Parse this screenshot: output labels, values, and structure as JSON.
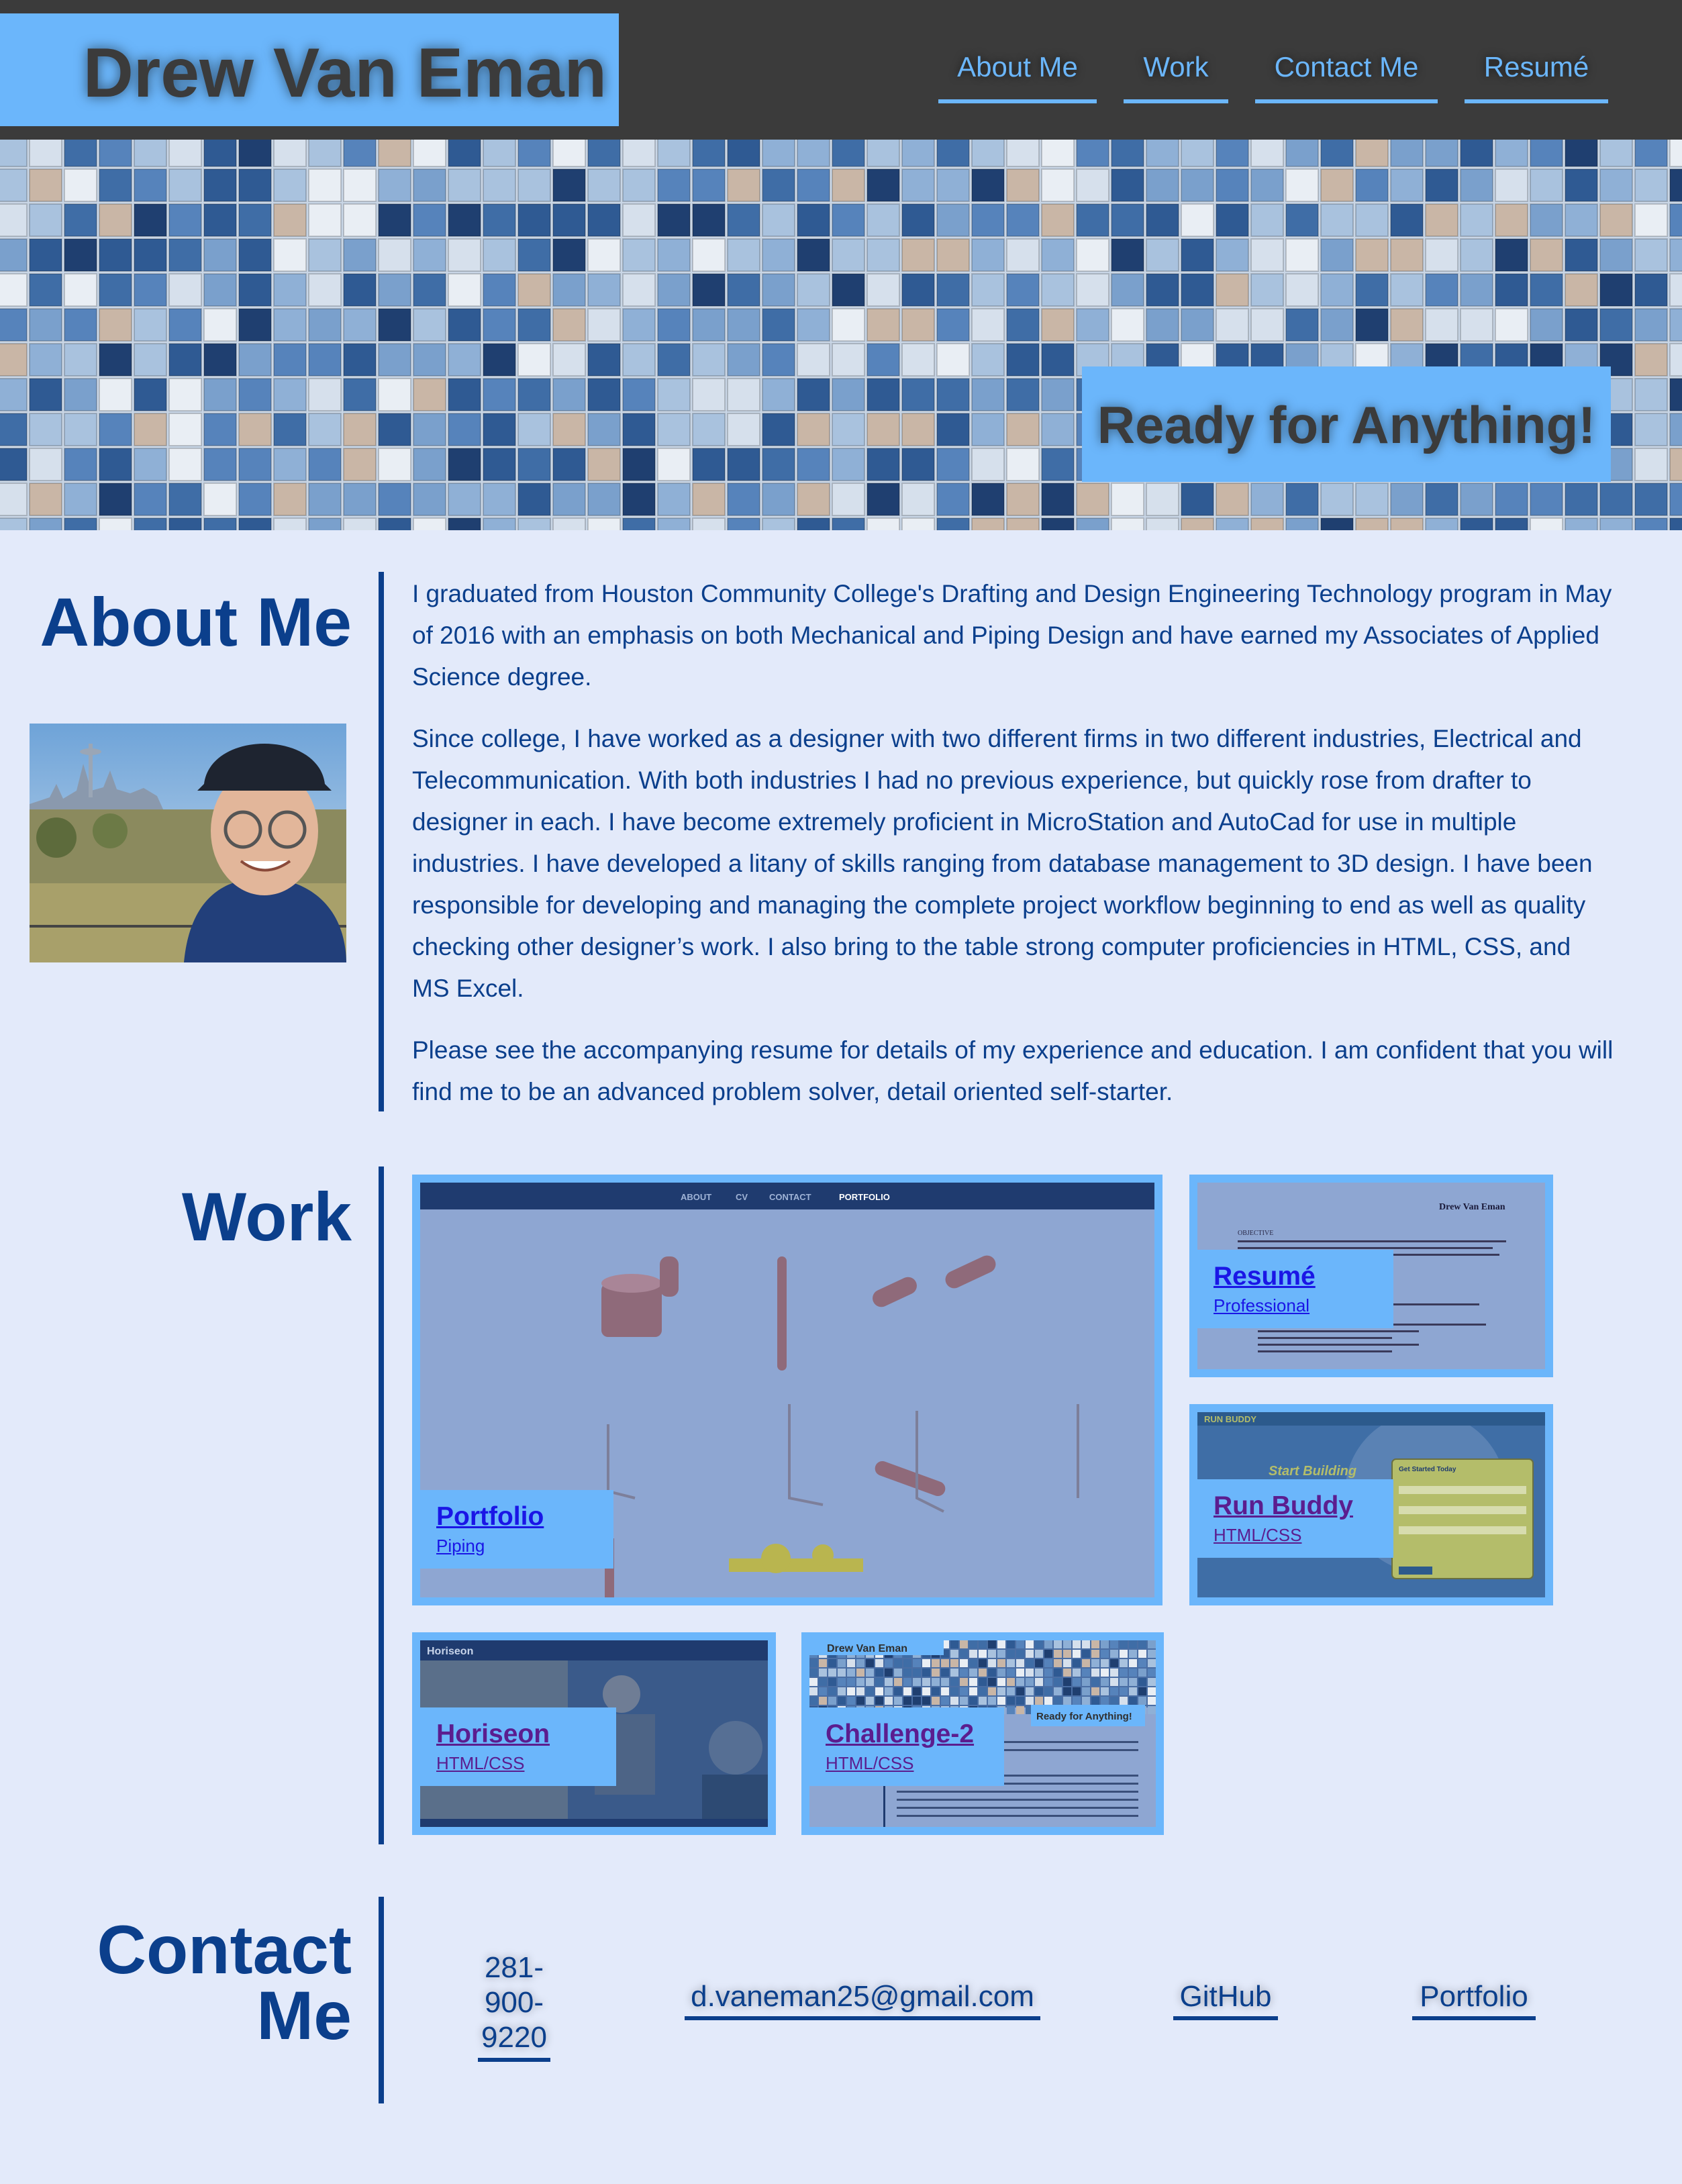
{
  "header": {
    "brand": "Drew Van Eman",
    "nav": [
      {
        "label": "About Me"
      },
      {
        "label": "Work"
      },
      {
        "label": "Contact Me"
      },
      {
        "label": "Resumé"
      }
    ]
  },
  "hero": {
    "tagline": "Ready for Anything!"
  },
  "about": {
    "title": "About Me",
    "paragraphs": [
      "I graduated from Houston Community College's Drafting and Design Engineering Technology program in May of 2016 with an emphasis on both Mechanical and Piping Design and have earned my Associates of Applied Science degree.",
      "Since college, I have worked as a designer with two different firms in two different industries, Electrical and Telecommunication. With both industries I had no previous experience, but quickly rose from drafter to designer in each. I have become extremely proficient in MicroStation and AutoCad for use in multiple industries. I have developed a litany of skills ranging from database management to 3D design. I have been responsible for developing and managing the complete project workflow beginning to end as well as quality checking other designer’s work. I also bring to the table strong computer proficiencies in HTML, CSS, and MS Excel.",
      "Please see the accompanying resume for details of my experience and education. I am confident that you will find me to be an advanced problem solver, detail oriented self-starter."
    ]
  },
  "work": {
    "title": "Work",
    "projects": [
      {
        "title": "Portfolio",
        "subtitle": "Piping"
      },
      {
        "title": "Resumé",
        "subtitle": "Professional"
      },
      {
        "title": "Run Buddy",
        "subtitle": "HTML/CSS"
      },
      {
        "title": "Horiseon",
        "subtitle": "HTML/CSS"
      },
      {
        "title": "Challenge-2",
        "subtitle": "HTML/CSS"
      }
    ],
    "thumbs": {
      "portfolio_nav": [
        "ABOUT",
        "CV",
        "CONTACT",
        "PORTFOLIO"
      ],
      "resume_name": "Drew Van Eman",
      "resume_objective": "OBJECTIVE",
      "runbuddy_brand": "RUN BUDDY",
      "runbuddy_headline": "Start Building",
      "runbuddy_form_title": "Get Started Today",
      "horiseon_brand": "Horiseon",
      "challenge_brand": "Drew Van Eman",
      "challenge_tagline": "Ready for Anything!"
    }
  },
  "contact": {
    "title": "Contact Me",
    "phone": "281-900-9220",
    "email": "d.vaneman25@gmail.com",
    "github": "GitHub",
    "portfolio": "Portfolio"
  },
  "colors": {
    "header_bg": "#3b3b3b",
    "accent": "#6bb6fb",
    "text": "#0b3f8c",
    "page_bg": "#e3eafa"
  }
}
